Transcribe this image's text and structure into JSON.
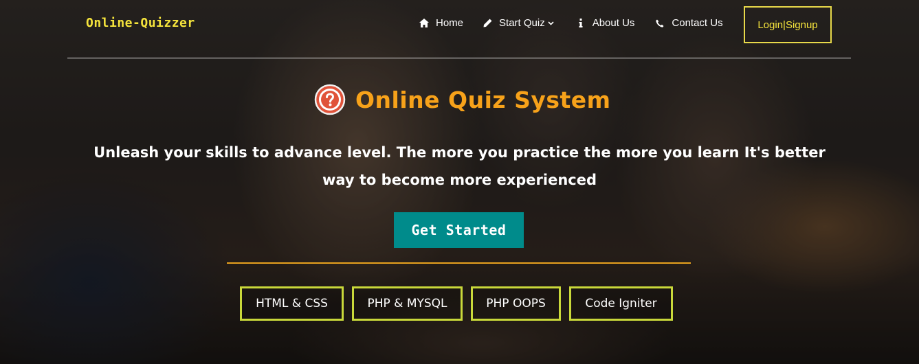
{
  "brand": {
    "name": "Online-Quizzer"
  },
  "nav": {
    "items": [
      {
        "label": "Home",
        "icon": "home-icon"
      },
      {
        "label": "Start Quiz",
        "icon": "pencil-icon",
        "has_dropdown": true
      },
      {
        "label": "About Us",
        "icon": "info-icon"
      },
      {
        "label": "Contact Us",
        "icon": "phone-icon"
      }
    ],
    "login_label": "Login|Signup"
  },
  "hero": {
    "icon": "question-circle-icon",
    "title": "Online Quiz System",
    "text": "Unleash your skills to advance level. The more you practice the more you learn It's better way to become more experienced",
    "cta_label": "Get Started",
    "tags": [
      "HTML & CSS",
      "PHP & MYSQL",
      "PHP OOPS",
      "Code Igniter"
    ]
  },
  "colors": {
    "brand": "#f5e43c",
    "title": "#f7a21a",
    "cta_bg": "#008b8b",
    "tag_border": "#c9d83a",
    "divider": "#e8a21e"
  }
}
